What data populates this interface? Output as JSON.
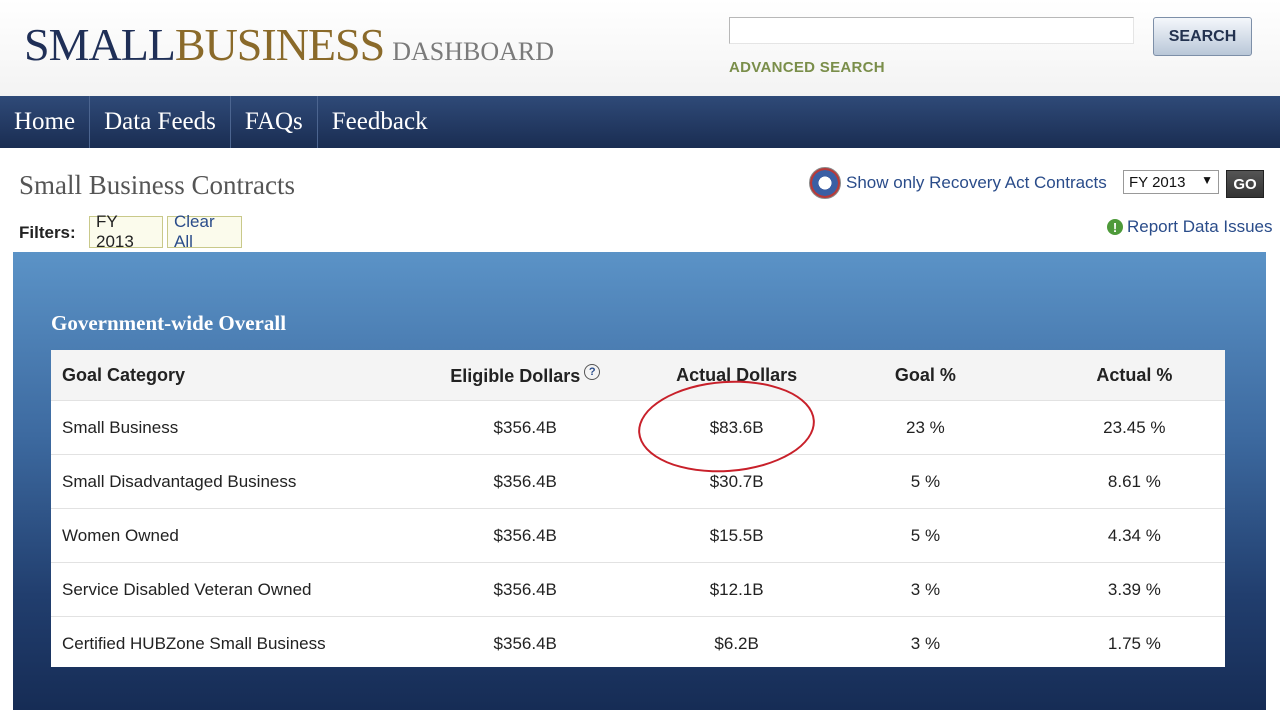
{
  "header": {
    "logo_small": "SMALL",
    "logo_business": "BUSINESS",
    "logo_dashboard": "DASHBOARD",
    "search_placeholder": "",
    "search_button": "SEARCH",
    "advanced_search": "ADVANCED SEARCH"
  },
  "nav": {
    "items": [
      {
        "label": "Home"
      },
      {
        "label": "Data Feeds"
      },
      {
        "label": "FAQs"
      },
      {
        "label": "Feedback"
      }
    ]
  },
  "page": {
    "title": "Small Business Contracts",
    "recovery_link": "Show only Recovery Act Contracts",
    "fy_select": "FY 2013",
    "go_button": "GO",
    "report_link": "Report Data Issues",
    "filters_label": "Filters:",
    "filter_chip": "FY 2013",
    "clear_all": "Clear All"
  },
  "panel": {
    "title": "Government-wide Overall",
    "columns": [
      "Goal Category",
      "Eligible Dollars",
      "Actual Dollars",
      "Goal %",
      "Actual %"
    ],
    "help_icon": "?",
    "rows": [
      [
        "Small Business",
        "$356.4B",
        "$83.6B",
        "23 %",
        "23.45 %"
      ],
      [
        "Small Disadvantaged Business",
        "$356.4B",
        "$30.7B",
        "5 %",
        "8.61 %"
      ],
      [
        "Women Owned",
        "$356.4B",
        "$15.5B",
        "5 %",
        "4.34 %"
      ],
      [
        "Service Disabled Veteran Owned",
        "$356.4B",
        "$12.1B",
        "3 %",
        "3.39 %"
      ],
      [
        "Certified HUBZone Small Business",
        "$356.4B",
        "$6.2B",
        "3 %",
        "1.75 %"
      ]
    ]
  },
  "colors": {
    "nav_bg": "#1a2d52",
    "logo_navy": "#1f2f57",
    "logo_gold": "#8a6a2a",
    "link_blue": "#2a4c8a",
    "highlight_circle": "#c8202a"
  }
}
